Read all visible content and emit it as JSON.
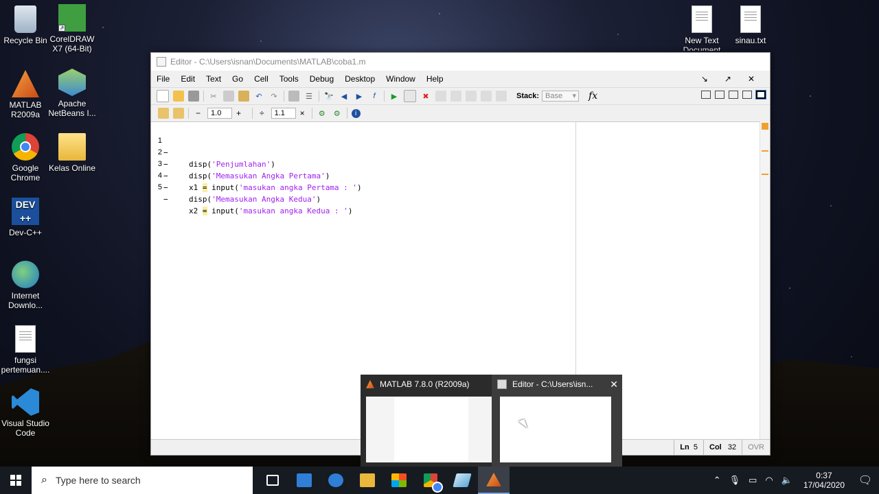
{
  "desktop": {
    "icons_left": [
      {
        "label": "Recycle Bin"
      },
      {
        "label": "CorelDRAW X7 (64-Bit)"
      },
      {
        "label": "MATLAB R2009a"
      },
      {
        "label": "Apache NetBeans I..."
      },
      {
        "label": "Google Chrome"
      },
      {
        "label": "Kelas Online"
      },
      {
        "label": "Dev-C++"
      },
      {
        "label": "Internet Downlo..."
      },
      {
        "label": "fungsi pertemuan...."
      },
      {
        "label": "Visual Studio Code"
      }
    ],
    "icons_right": [
      {
        "label": "New Text Document"
      },
      {
        "label": "sinau.txt"
      }
    ]
  },
  "editor": {
    "title": "Editor - C:\\Users\\isnan\\Documents\\MATLAB\\coba1.m",
    "menu": [
      "File",
      "Edit",
      "Text",
      "Go",
      "Cell",
      "Tools",
      "Debug",
      "Desktop",
      "Window",
      "Help"
    ],
    "stack_label": "Stack:",
    "stack_value": "Base",
    "fx_label": "fx",
    "cell_minus": "−",
    "cell_value1": "1.0",
    "cell_plus": "+",
    "cell_divide": "÷",
    "cell_value2": "1.1",
    "cell_times": "×",
    "code_lines": [
      {
        "num": "1",
        "pre": "disp(",
        "str": "'Penjumlahan'",
        "post": ")"
      },
      {
        "num": "2",
        "pre": "disp(",
        "str": "'Memasukan Angka Pertama'",
        "post": ")"
      },
      {
        "num": "3",
        "pre": "x1 ",
        "eq": "=",
        "mid": " input(",
        "str": "'masukan angka Pertama : '",
        "post": ")"
      },
      {
        "num": "4",
        "pre": "disp(",
        "str": "'Memasukan Angka Kedua'",
        "post": ")"
      },
      {
        "num": "5",
        "pre": "x2 ",
        "eq": "=",
        "mid": " input(",
        "str": "'masukan angka Kedua : '",
        "post": ")"
      }
    ],
    "status": {
      "ln_label": "Ln",
      "ln": "5",
      "col_label": "Col",
      "col": "32",
      "ovr": "OVR"
    }
  },
  "preview": {
    "items": [
      {
        "title": "MATLAB  7.8.0 (R2009a)"
      },
      {
        "title": "Editor - C:\\Users\\isn..."
      }
    ]
  },
  "taskbar": {
    "search_placeholder": "Type here to search",
    "time": "0:37",
    "date": "17/04/2020"
  },
  "colors": {
    "string": "#a020f0",
    "taskbar": "#161a21",
    "scroll_marker": "#f0a030"
  }
}
